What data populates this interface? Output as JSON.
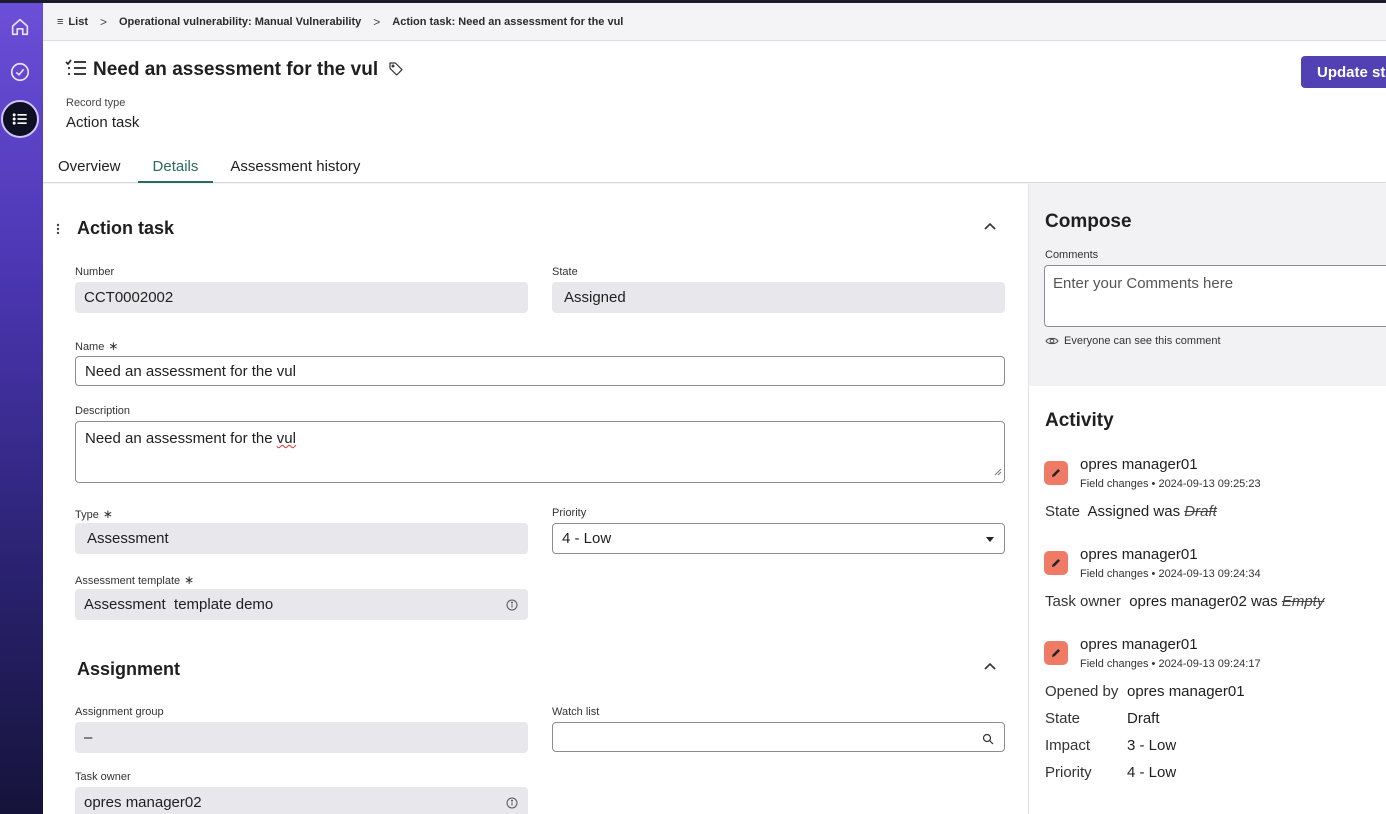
{
  "breadcrumb": {
    "items": [
      "List",
      "Operational vulnerability: Manual Vulnerability",
      "Action task: Need an assessment for the vul"
    ]
  },
  "header": {
    "title": "Need an assessment for the vul",
    "record_type_label": "Record type",
    "record_type_value": "Action task",
    "update_button": "Update sta",
    "tabs": [
      "Overview",
      "Details",
      "Assessment history"
    ],
    "active_tab": "Details"
  },
  "action_task": {
    "section_title": "Action task",
    "number_label": "Number",
    "number_value": "CCT0002002",
    "state_label": "State",
    "state_value": "Assigned",
    "name_label": "Name",
    "name_value": "Need an assessment for the vul",
    "description_label": "Description",
    "description_value_prefix": "Need an assessment for the ",
    "description_value_misspelled": "vul",
    "type_label": "Type",
    "type_value": "Assessment",
    "priority_label": "Priority",
    "priority_value": "4 - Low",
    "template_label": "Assessment template",
    "template_value": "Assessment  template demo",
    "required_mark": "∗"
  },
  "assignment": {
    "section_title": "Assignment",
    "group_label": "Assignment group",
    "group_value": "–",
    "watch_label": "Watch list",
    "watch_value": "",
    "owner_label": "Task owner",
    "owner_value": "opres manager02"
  },
  "compose": {
    "title": "Compose",
    "comments_label": "Comments",
    "comments_placeholder": "Enter your Comments here",
    "visibility_note": "Everyone can see this comment"
  },
  "activity": {
    "title": "Activity",
    "entries": [
      {
        "user": "opres manager01",
        "meta": "Field changes • 2024-09-13 09:25:23",
        "field": "State",
        "new": "Assigned was",
        "old": "Draft"
      },
      {
        "user": "opres manager01",
        "meta": "Field changes • 2024-09-13 09:24:34",
        "field": "Task owner",
        "new": "opres manager02 was",
        "old": "Empty"
      },
      {
        "user": "opres manager01",
        "meta": "Field changes • 2024-09-13 09:24:17",
        "pairs": [
          {
            "k": "Opened by",
            "v": "opres manager01"
          },
          {
            "k": "State",
            "v": "Draft"
          },
          {
            "k": "Impact",
            "v": "3 - Low"
          },
          {
            "k": "Priority",
            "v": "4 - Low"
          }
        ]
      }
    ]
  },
  "colors": {
    "primary_button": "#5141b5",
    "active_tab": "#2c6a5e",
    "activity_icon": "#ef7b67",
    "readonly_field": "#e8e8ec"
  }
}
